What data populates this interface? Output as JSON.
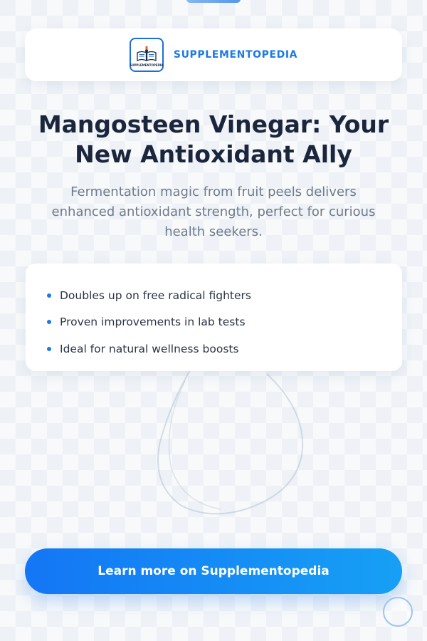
{
  "brand": {
    "name": "SUPPLEMENTOPEDIA",
    "logo_text": "SUPPLEMENTOPEDIA",
    "accent_color": "#1a7ae6"
  },
  "hero": {
    "headline_line1": "Mangosteen Vinegar: Your",
    "headline_line2": "New Antioxidant Ally",
    "subhead_line1": "Fermentation magic from fruit peels delivers",
    "subhead_line2": "enhanced antioxidant strength, perfect for curious",
    "subhead_line3": "health seekers."
  },
  "benefits": {
    "items": [
      {
        "label": "Doubles up on free radical fighters"
      },
      {
        "label": "Proven improvements in lab tests"
      },
      {
        "label": "Ideal for natural wellness boosts"
      }
    ]
  },
  "cta": {
    "label": "Learn more on Supplementopedia",
    "color_start": "#1476f5",
    "color_end": "#16a0f5"
  },
  "icons": {
    "logo": "open-book-icon",
    "floating": "circle-button-icon"
  }
}
